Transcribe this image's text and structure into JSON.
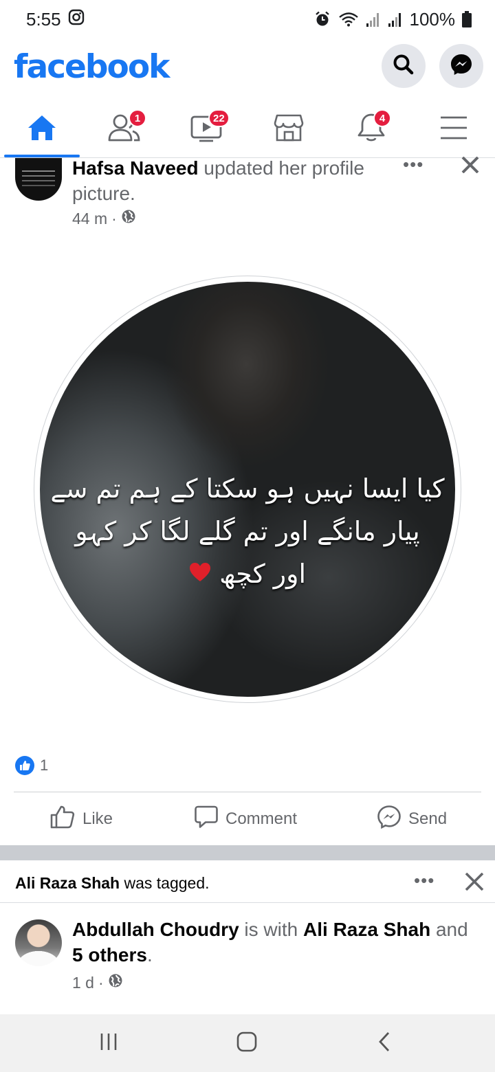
{
  "status_bar": {
    "time": "5:55",
    "battery": "100%"
  },
  "header": {
    "logo_text": "facebook",
    "brand_color": "#1877f2"
  },
  "nav": {
    "tabs": [
      {
        "name": "home",
        "icon": "home-icon",
        "badge": ""
      },
      {
        "name": "friends",
        "icon": "friends-icon",
        "badge": "1"
      },
      {
        "name": "watch",
        "icon": "video-icon",
        "badge": "22"
      },
      {
        "name": "marketplace",
        "icon": "marketplace-icon",
        "badge": ""
      },
      {
        "name": "notifications",
        "icon": "bell-icon",
        "badge": "4"
      },
      {
        "name": "menu",
        "icon": "hamburger-icon",
        "badge": ""
      }
    ]
  },
  "post1": {
    "author": "Hafsa Naveed",
    "action": " updated her profile picture.",
    "time": "44 m",
    "separator": "·",
    "image_text_lines": [
      "کیا ایسا نہیں ہو سکتا کے ہم تم سے",
      "پیار مانگے اور تم گلے لگا کر کہو",
      "اور کچھ"
    ],
    "reaction_count": "1",
    "actions": {
      "like": "Like",
      "comment": "Comment",
      "send": "Send"
    }
  },
  "post2": {
    "tag_name": "Ali Raza Shah",
    "tag_action": " was tagged.",
    "author": "Abdullah Choudry",
    "with_text": " is with ",
    "with_name": "Ali Raza Shah",
    "and_text": " and ",
    "others": "5 others",
    "period": ".",
    "time": "1 d",
    "separator": "·"
  },
  "colors": {
    "accent": "#1877f2",
    "badge": "#e41e3f",
    "secondary_text": "#65676b"
  }
}
